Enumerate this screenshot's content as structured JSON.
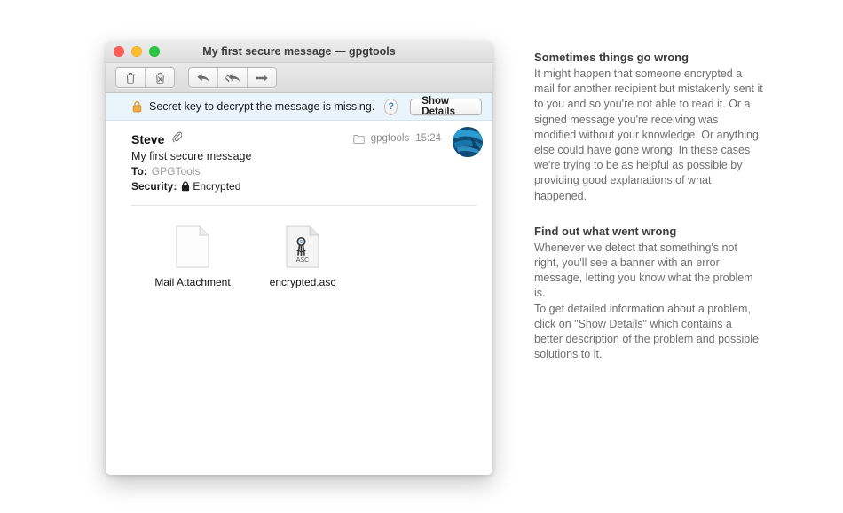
{
  "window": {
    "title": "My first secure message — gpgtools",
    "traffic_lights": [
      {
        "name": "close",
        "color": "#ff5f57"
      },
      {
        "name": "minimize",
        "color": "#febc2e"
      },
      {
        "name": "zoom",
        "color": "#28c840"
      }
    ],
    "toolbar": {
      "groups": [
        [
          {
            "icon": "trash-icon",
            "label": "Delete"
          },
          {
            "icon": "junk-icon",
            "label": "Move to Junk"
          }
        ],
        [
          {
            "icon": "reply-icon",
            "label": "Reply"
          },
          {
            "icon": "reply-all-icon",
            "label": "Reply All"
          },
          {
            "icon": "forward-icon",
            "label": "Forward"
          }
        ]
      ]
    }
  },
  "banner": {
    "lock_icon": "lock-icon",
    "lock_color": "#e8a33d",
    "message": "Secret key to decrypt the message is missing.",
    "help_label": "?",
    "details_button": "Show Details",
    "background": "#eaf4fb"
  },
  "message": {
    "sender": "Steve",
    "attachment_indicator_icon": "paperclip-icon",
    "subject": "My first secure message",
    "to_label": "To:",
    "to_value": "GPGTools",
    "security_label": "Security:",
    "security_icon": "lock-closed-icon",
    "security_value": "Encrypted",
    "mailbox_icon": "folder-icon",
    "mailbox": "gpgtools",
    "time": "15:24",
    "avatar_icon": "avatar"
  },
  "attachments": [
    {
      "icon": "blank-document-icon",
      "label": "Mail Attachment"
    },
    {
      "icon": "asc-key-file-icon",
      "badge": "ASC",
      "label": "encrypted.asc"
    }
  ],
  "sidebar": {
    "sections": [
      {
        "heading": "Sometimes things go wrong",
        "body": "It might happen that someone encrypted a mail for another recipient but mistakenly sent it to you and so you're not able to read it. Or a signed message you're receiving was modified without your knowledge. Or anything else could have gone wrong. In these cases we're trying to be as helpful as possible by providing good explanations of what happened."
      },
      {
        "heading": "Find out what went wrong",
        "body1": "Whenever we detect that something's not right, you'll see a banner with an error message, letting you know what the problem is.",
        "body2": "To get detailed information about a problem, click on \"Show Details\" which contains a better description of the problem and possible solutions to it."
      }
    ]
  }
}
